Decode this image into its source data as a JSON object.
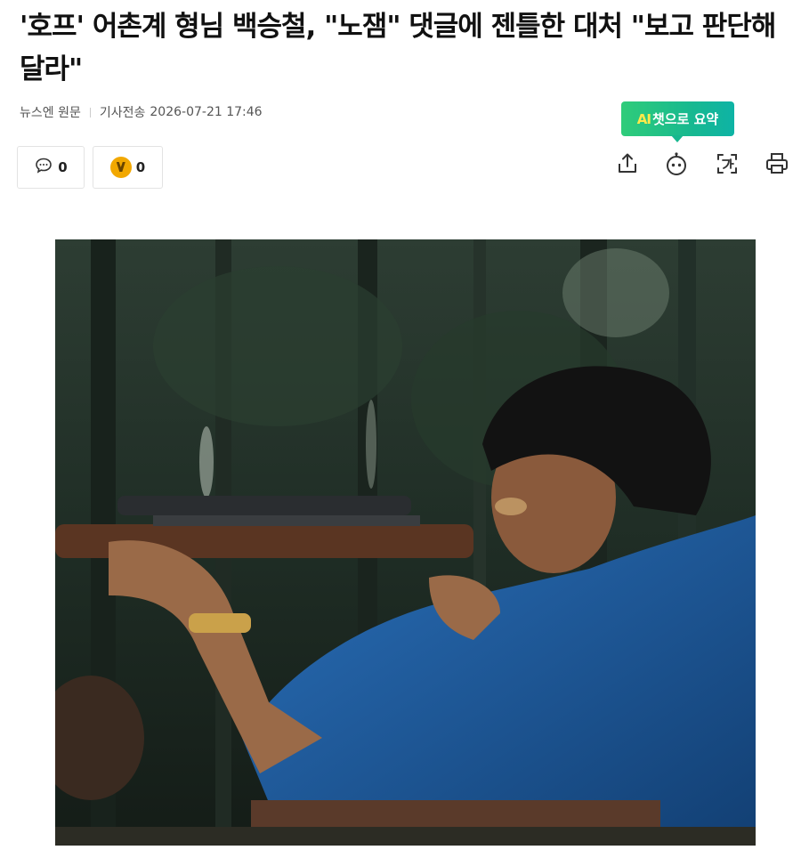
{
  "article": {
    "title": "'호프' 어촌계 형님 백승철, \"노잼\" 댓글에 젠틀한 대처 \"보고 판단해달라\"",
    "source": "뉴스엔 원문",
    "sent_label": "기사전송",
    "datetime": "2026-07-21 17:46"
  },
  "counters": {
    "comments": "0",
    "reactions": "0"
  },
  "ai_summary": {
    "ai": "AI",
    "label": "챗으로 요약"
  },
  "icons": {
    "share": "share-icon",
    "chatbot": "chatbot-icon",
    "translate": "translate-icon",
    "print": "print-icon",
    "comment": "comment-icon",
    "reaction": "reaction-coin-icon"
  },
  "colors": {
    "ai_badge_start": "#2fcc7a",
    "ai_badge_end": "#0eb3a5",
    "ai_text_highlight": "#ffe94a",
    "coin": "#f2a800"
  }
}
